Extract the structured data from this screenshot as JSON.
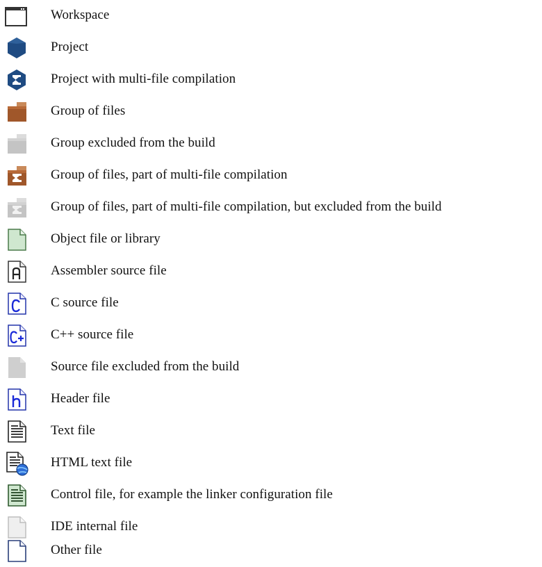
{
  "legend": {
    "items": [
      {
        "icon": "workspace-icon",
        "label": "Workspace"
      },
      {
        "icon": "project-icon",
        "label": "Project"
      },
      {
        "icon": "project-multifile-icon",
        "label": "Project with multi-file compilation"
      },
      {
        "icon": "group-icon",
        "label": "Group of files"
      },
      {
        "icon": "group-excluded-icon",
        "label": "Group excluded from the build"
      },
      {
        "icon": "group-multifile-icon",
        "label": "Group of files, part of multi-file compilation"
      },
      {
        "icon": "group-multifile-excluded-icon",
        "label": "Group of files, part of multi-file compilation, but excluded from the build"
      },
      {
        "icon": "object-file-icon",
        "label": "Object file or library"
      },
      {
        "icon": "assembler-file-icon",
        "label": "Assembler source file"
      },
      {
        "icon": "c-file-icon",
        "label": "C source file"
      },
      {
        "icon": "cpp-file-icon",
        "label": "C++ source file"
      },
      {
        "icon": "source-excluded-icon",
        "label": "Source file excluded from the build"
      },
      {
        "icon": "header-file-icon",
        "label": "Header file"
      },
      {
        "icon": "text-file-icon",
        "label": "Text file"
      },
      {
        "icon": "html-file-icon",
        "label": "HTML text file"
      },
      {
        "icon": "control-file-icon",
        "label": "Control file, for example the linker configuration file"
      },
      {
        "icon": "ide-internal-file-icon",
        "label": "IDE internal file"
      },
      {
        "icon": "other-file-icon",
        "label": "Other file"
      }
    ]
  }
}
